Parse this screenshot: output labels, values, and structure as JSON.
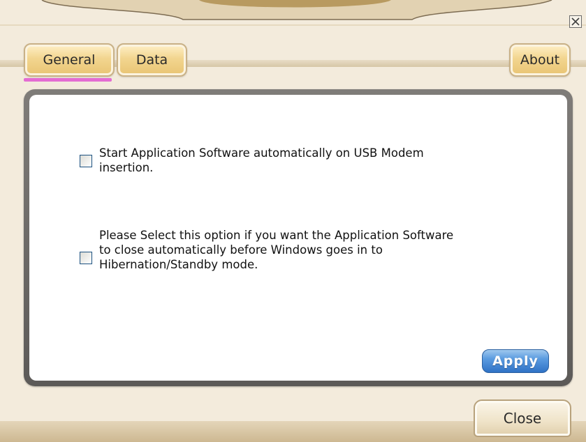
{
  "window": {
    "close_icon": "close-icon"
  },
  "tabs": [
    {
      "label": "General",
      "selected": true
    },
    {
      "label": "Data",
      "selected": false
    },
    {
      "label": "About",
      "selected": false
    }
  ],
  "options": [
    {
      "label": "Start Application Software automatically on USB Modem\ninsertion.",
      "checked": false
    },
    {
      "label": "Please Select this option if you want the Application Software\nto close automatically before Windows goes in to\nHibernation/Standby mode.",
      "checked": false
    }
  ],
  "buttons": {
    "apply": "Apply",
    "close": "Close"
  },
  "colors": {
    "tab_selected_underline": "#e46cd2",
    "apply_button": "#3a7fd0",
    "tab_gold": "#f2d58f"
  }
}
